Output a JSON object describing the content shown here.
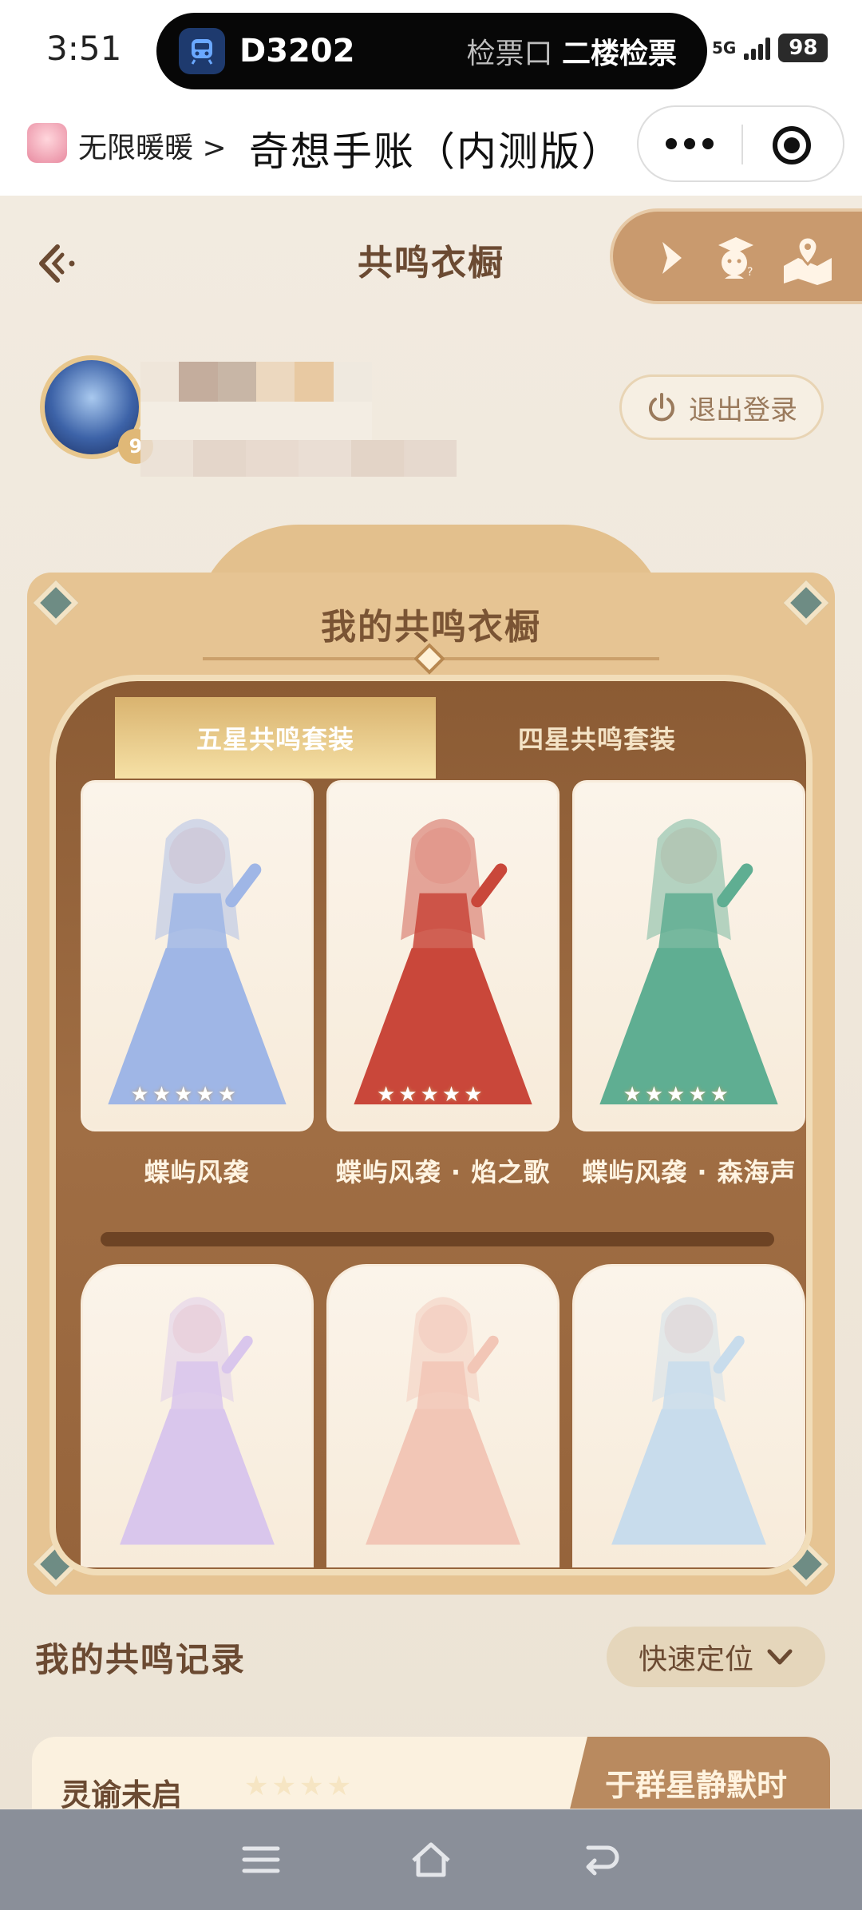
{
  "status_bar": {
    "time": "3:51",
    "train_number": "D3202",
    "gate_prefix": "检票口",
    "gate_name": "二楼检票",
    "network": "5G",
    "battery": "98"
  },
  "miniprogram": {
    "app_name": "无限暖暖",
    "chevron": ">",
    "title": "奇想手账（内测版）"
  },
  "page": {
    "title": "共鸣衣橱",
    "profile": {
      "level": "9",
      "logout_label": "退出登录"
    },
    "wardrobe": {
      "title": "我的共鸣衣橱",
      "tabs": [
        {
          "label": "五星共鸣套装",
          "active": true
        },
        {
          "label": "四星共鸣套装",
          "active": false
        }
      ],
      "outfits": [
        {
          "name": "蝶屿风袭",
          "stars": "★★★★★",
          "color": "#9fb6e6"
        },
        {
          "name": "蝶屿风袭 · 焰之歌",
          "stars": "★★★★★",
          "color": "#c9473a"
        },
        {
          "name": "蝶屿风袭 · 森海声",
          "stars": "★★★★★",
          "color": "#5fae92"
        },
        {
          "name": "",
          "stars": "",
          "color": "#d9c6ec"
        },
        {
          "name": "",
          "stars": "",
          "color": "#f2c6b6"
        },
        {
          "name": "",
          "stars": "",
          "color": "#c8dcec"
        }
      ]
    },
    "records": {
      "title": "我的共鸣记录",
      "locate_label": "快速定位",
      "items": [
        {
          "name": "灵谕未启",
          "stars": "★★★★",
          "tag": "于群星静默时"
        }
      ]
    }
  },
  "icons": {
    "back": "back-arrow-icon",
    "play": "play-icon",
    "scholar": "scholar-dog-icon",
    "map": "map-pin-icon",
    "power": "power-icon",
    "chevron_down": "chevron-down-icon"
  }
}
